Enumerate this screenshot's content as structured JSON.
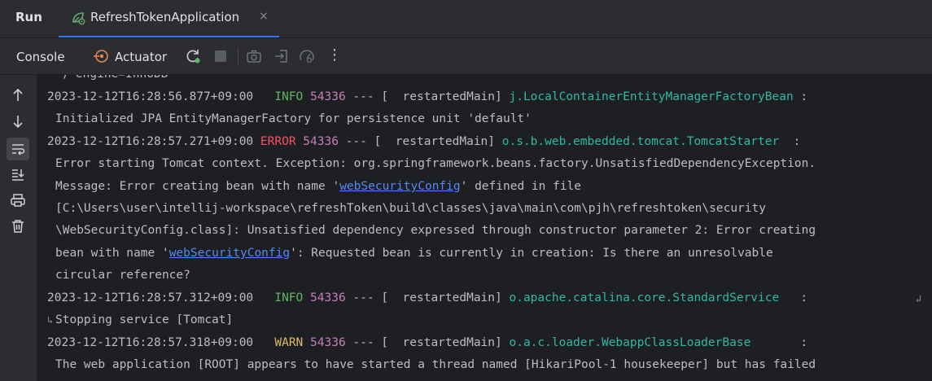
{
  "header": {
    "panel_title": "Run",
    "tab_label": "RefreshTokenApplication",
    "tab_close": "×"
  },
  "toolbar": {
    "console_label": "Console",
    "actuator_label": "Actuator",
    "more_glyph": "⋮"
  },
  "console": {
    "partial_top": "  ) engine=InnoDB",
    "entries": [
      {
        "timestamp": "2023-12-12T16:28:56.877+09:00",
        "level": " INFO",
        "pid": "54336",
        "sep": " --- [  restartedMain] ",
        "logger": "j.LocalContainerEntityManagerFactoryBean",
        "tail": " :",
        "message": "Initialized JPA EntityManagerFactory for persistence unit 'default'"
      },
      {
        "timestamp": "2023-12-12T16:28:57.271+09:00",
        "level": "ERROR",
        "pid": "54336",
        "sep": " --- [  restartedMain] ",
        "logger": "o.s.b.web.embedded.tomcat.TomcatStarter",
        "tail": "  :",
        "message_lines": [
          "Error starting Tomcat context. Exception: org.springframework.beans.factory.UnsatisfiedDependencyException.",
          "Message: Error creating bean with name '",
          "[C:\\Users\\user\\intellij-workspace\\refreshToken\\build\\classes\\java\\main\\com\\pjh\\refreshtoken\\security",
          "\\WebSecurityConfig.class]: Unsatisfied dependency expressed through constructor parameter 2: Error creating",
          "bean with name '",
          "circular reference?"
        ],
        "link": "webSecurityConfig",
        "after_link_1": "' defined in file",
        "after_link_2": "': Requested bean is currently in creation: Is there an unresolvable"
      },
      {
        "timestamp": "2023-12-12T16:28:57.312+09:00",
        "level": " INFO",
        "pid": "54336",
        "sep": " --- [  restartedMain] ",
        "logger": "o.apache.catalina.core.StandardService",
        "tail": "   :",
        "message": "Stopping service [Tomcat]"
      },
      {
        "timestamp": "2023-12-12T16:28:57.318+09:00",
        "level": " WARN",
        "pid": "54336",
        "sep": " --- [  restartedMain] ",
        "logger": "o.a.c.loader.WebappClassLoaderBase",
        "tail": "       :",
        "message": "The web application [ROOT] appears to have started a thread named [HikariPool-1 housekeeper] but has failed"
      }
    ]
  },
  "colors": {
    "info": "#5fb865",
    "error": "#f75464",
    "warn": "#e0bb65",
    "pid": "#c77dbb",
    "logger": "#2fb8a8",
    "link": "#548af7"
  },
  "icons": {
    "tab": "spring-boot-run-icon",
    "actuator": "actuator-icon",
    "rerun": "rerun-icon",
    "stop": "stop-icon",
    "screenshot": "camera-icon",
    "exit": "exit-icon",
    "gauge": "gauge-icon",
    "more": "more-vertical-icon",
    "up": "arrow-up-icon",
    "down": "arrow-down-icon",
    "softwrap": "soft-wrap-icon",
    "scroll_end": "scroll-to-end-icon",
    "print": "print-icon",
    "clear": "trash-icon"
  }
}
